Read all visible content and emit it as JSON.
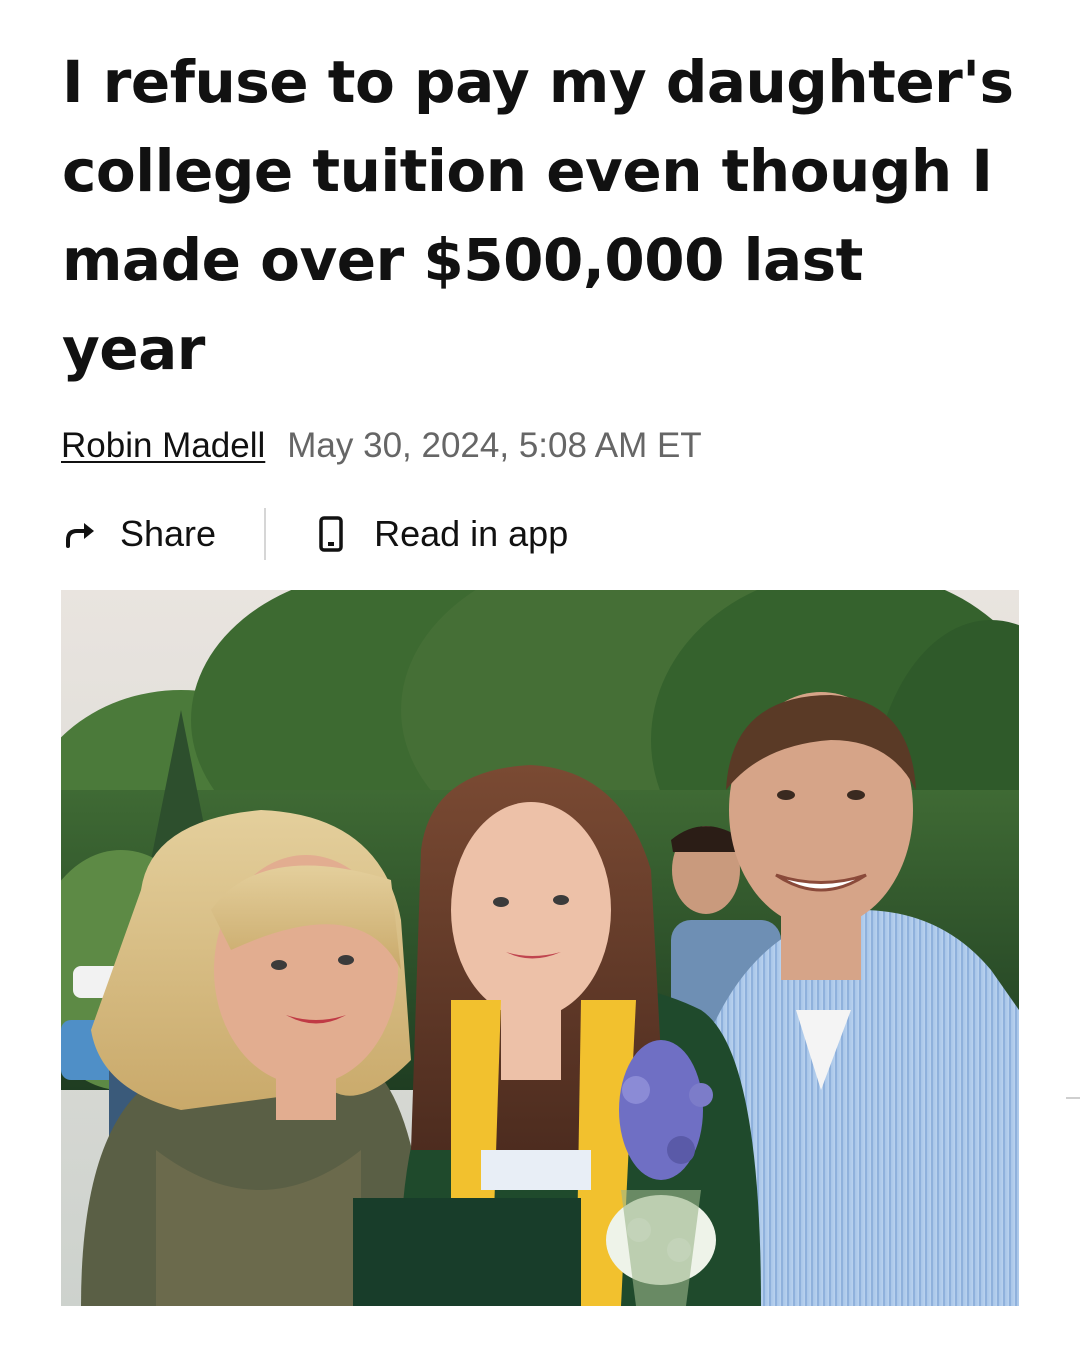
{
  "article": {
    "headline": "I refuse to pay my daughter's college tuition even though I made over $500,000 last year",
    "author": "Robin Madell",
    "timestamp": "May 30, 2024, 5:08 AM ET",
    "actions": {
      "share_label": "Share",
      "share_icon": "share-arrow-icon",
      "read_in_app_label": "Read in app",
      "read_in_app_icon": "phone-icon"
    },
    "photo": {
      "alt": "Three people standing outdoors at a graduation in front of trees; a young woman in a green gown with a yellow stole holding a diploma cover and flowers, between a blonde woman and a man in a light blue shirt"
    }
  },
  "colors": {
    "headline": "#111111",
    "timestamp": "#666666",
    "divider": "#d6d6d6",
    "stole": "#f2c12e",
    "gown": "#1f4a2c",
    "shirt": "#a9c6e8"
  }
}
